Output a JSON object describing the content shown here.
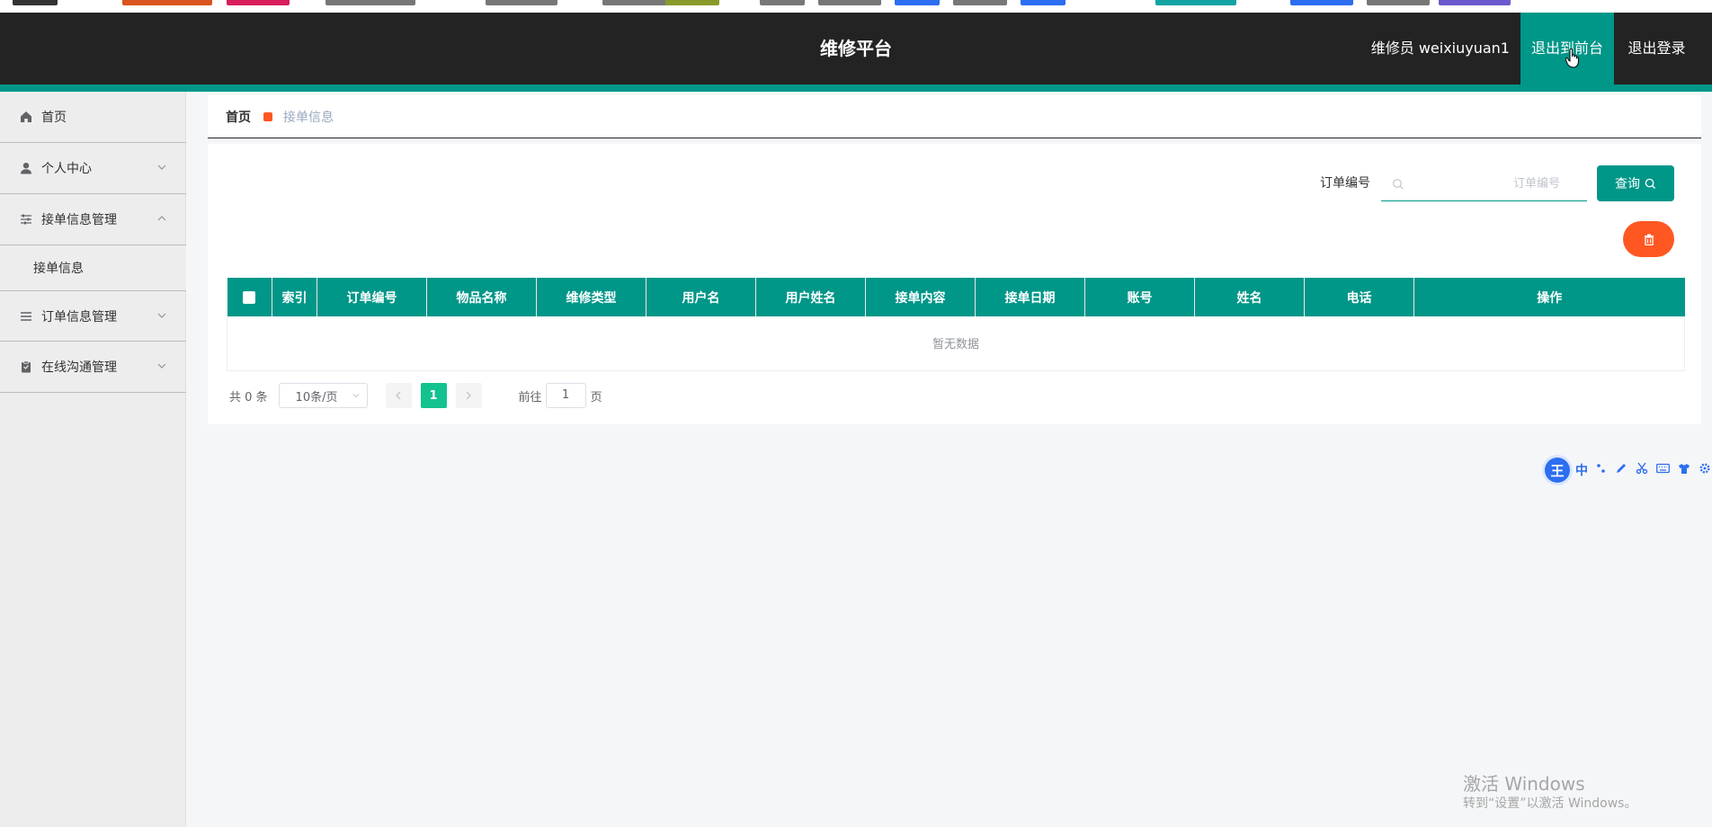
{
  "header": {
    "title": "维修平台",
    "user_label": "维修员 weixiuyuan1",
    "front_button": "退出到前台",
    "logout_button": "退出登录"
  },
  "sidebar": {
    "items": [
      {
        "label": "首页",
        "icon": "home-icon"
      },
      {
        "label": "个人中心",
        "icon": "user-icon"
      },
      {
        "label": "接单信息管理",
        "icon": "sliders-icon",
        "expanded": true
      },
      {
        "label": "订单信息管理",
        "icon": "list-icon"
      },
      {
        "label": "在线沟通管理",
        "icon": "clipboard-icon"
      }
    ],
    "sub_items": [
      {
        "label": "接单信息"
      }
    ]
  },
  "breadcrumb": {
    "home": "首页",
    "current": "接单信息"
  },
  "search": {
    "label": "订单编号",
    "placeholder": "订单编号",
    "value": "",
    "button": "查询"
  },
  "table": {
    "columns": [
      "索引",
      "订单编号",
      "物品名称",
      "维修类型",
      "用户名",
      "用户姓名",
      "接单内容",
      "接单日期",
      "账号",
      "姓名",
      "电话",
      "操作"
    ],
    "rows": [],
    "empty_text": "暂无数据"
  },
  "pagination": {
    "total": "共 0 条",
    "page_size": "10条/页",
    "current_page": "1",
    "goto_label": "前往",
    "goto_value": "1",
    "page_suffix": "页"
  },
  "ime": {
    "logo": "王",
    "mode": "中"
  },
  "watermark": {
    "title": "激活 Windows",
    "subtitle": "转到“设置”以激活 Windows。"
  },
  "colors": {
    "header_bg": "#232323",
    "accent": "#009688",
    "danger": "#ff5722",
    "page_active": "#13c28f"
  }
}
